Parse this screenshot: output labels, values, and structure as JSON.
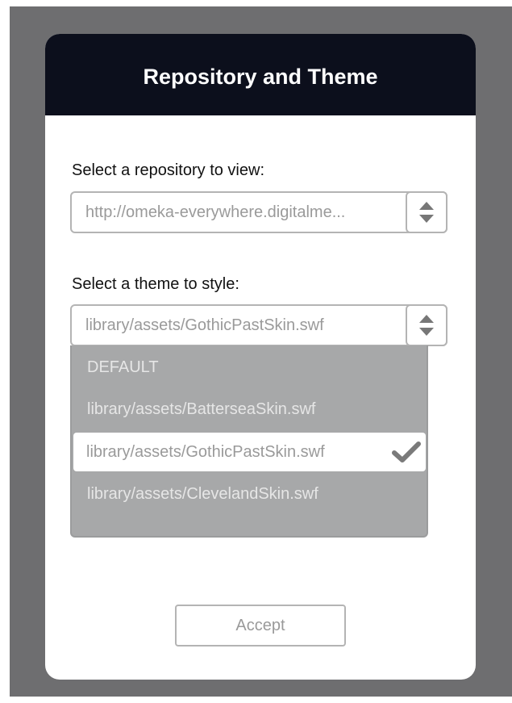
{
  "dialog": {
    "title": "Repository and Theme"
  },
  "repository": {
    "label": "Select a repository to view:",
    "value": "http://omeka-everywhere.digitalme..."
  },
  "theme": {
    "label": "Select a theme to style:",
    "value": "library/assets/GothicPastSkin.swf",
    "options": [
      "DEFAULT",
      "library/assets/BatterseaSkin.swf",
      "library/assets/GothicPastSkin.swf",
      "library/assets/ClevelandSkin.swf"
    ],
    "selected_index": 2
  },
  "accept_label": "Accept",
  "colors": {
    "header_bg": "#0c0f1c",
    "backdrop": "#6e6e70",
    "dropdown_bg": "#a7a8a9",
    "check": "#7a7a7a"
  }
}
